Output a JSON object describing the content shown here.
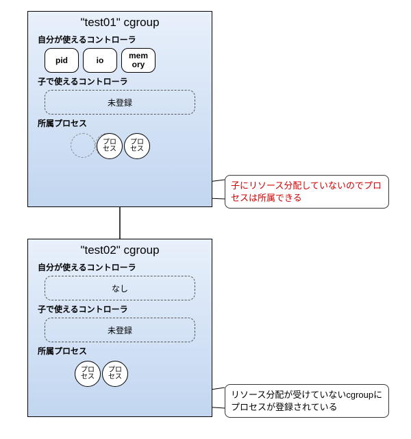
{
  "cgroup1": {
    "title": "\"test01\" cgroup",
    "label_self": "自分が使えるコントローラ",
    "controllers": {
      "pid": "pid",
      "io": "io",
      "memory": "mem\nory"
    },
    "label_child": "子で使えるコントローラ",
    "child_status": "未登録",
    "label_procs": "所属プロセス",
    "proc": "プロ\nセス"
  },
  "cgroup2": {
    "title": "\"test02\" cgroup",
    "label_self": "自分が使えるコントローラ",
    "self_status": "なし",
    "label_child": "子で使えるコントローラ",
    "child_status": "未登録",
    "label_procs": "所属プロセス",
    "proc": "プロ\nセス"
  },
  "callout1": "子にリソース分配していないのでプロセスは所属できる",
  "callout2": "リソース分配が受けていないcgroupにプロセスが登録されている"
}
